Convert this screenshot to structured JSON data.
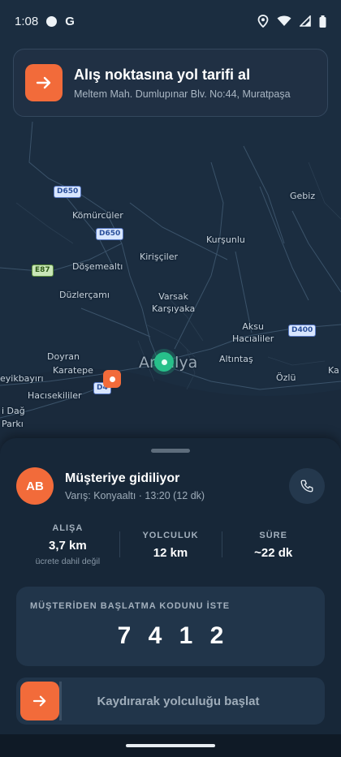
{
  "status_bar": {
    "time": "1:08",
    "icons": [
      "circle-dot-icon",
      "google-g-icon",
      "location-pin-icon",
      "wifi-icon",
      "signal-icon",
      "battery-icon"
    ],
    "g_letter": "G"
  },
  "top_card": {
    "title": "Alış noktasına yol tarifi al",
    "address": "Meltem Mah. Dumlupınar Blv. No:44, Muratpaşa",
    "icon": "arrow-right-icon"
  },
  "map": {
    "labels": {
      "gebiz": "Gebiz",
      "komurculer": "Kömürcüler",
      "kursunlu": "Kurşunlu",
      "kiriscciler": "Kirişçiler",
      "dosemealti": "Döşemealtı",
      "duzlercami": "Düzlerçamı",
      "varsak": "Varsak\nKarşıyaka",
      "aksu": "Aksu\nHacıaliler",
      "doyran": "Doyran",
      "karatepe": "Karatepe",
      "altintas": "Altıntaş",
      "eyikbayiri": "eyikbayırı",
      "hacisekililer": "Hacısekililer",
      "ozlu": "Özlü",
      "kar": "Ka",
      "dag": "i Dağ\nParkı",
      "antalya": "Antalya"
    },
    "shields": {
      "d650a": "D650",
      "d650b": "D650",
      "e87": "E87",
      "d400": "D400",
      "d4": "D4"
    },
    "colors": {
      "dest": "#f26b3a",
      "car": "#27c08a"
    }
  },
  "sheet": {
    "driver": {
      "initials": "AB",
      "status": "Müşteriye gidiliyor",
      "eta": "Varış: Konyaaltı · 13:20 (12 dk)"
    },
    "stats": [
      {
        "label": "ALIŞA",
        "value": "3,7 km",
        "note": "ücrete dahil değil"
      },
      {
        "label": "YOLCULUK",
        "value": "12 km"
      },
      {
        "label": "SÜRE",
        "value": "~22 dk"
      }
    ],
    "code": {
      "label": "MÜŞTERİDEN BAŞLATMA KODUNU İSTE",
      "digits": [
        "7",
        "4",
        "1",
        "2"
      ]
    },
    "slide": {
      "label": "Kaydırarak yolculuğu başlat"
    }
  },
  "accent": "#f26b3a"
}
